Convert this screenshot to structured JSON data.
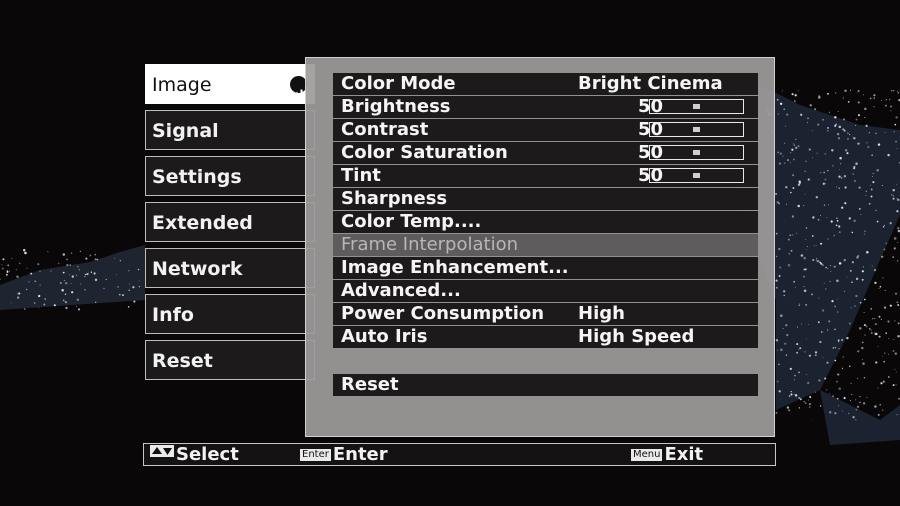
{
  "sidebar": {
    "tabs": [
      {
        "label": "Image",
        "active": true
      },
      {
        "label": "Signal"
      },
      {
        "label": "Settings"
      },
      {
        "label": "Extended"
      },
      {
        "label": "Network"
      },
      {
        "label": "Info"
      },
      {
        "label": "Reset"
      }
    ]
  },
  "menu": {
    "items": [
      {
        "label": "Color Mode",
        "value": "Bright Cinema"
      },
      {
        "label": "Brightness",
        "number": "50",
        "level": 0.5
      },
      {
        "label": "Contrast",
        "number": "50",
        "level": 0.5
      },
      {
        "label": "Color Saturation",
        "number": "50",
        "level": 0.5
      },
      {
        "label": "Tint",
        "number": "50",
        "level": 0.5
      },
      {
        "label": "Sharpness"
      },
      {
        "label": "Color Temp...."
      },
      {
        "label": "Frame Interpolation",
        "disabled": true
      },
      {
        "label": "Image Enhancement..."
      },
      {
        "label": "Advanced..."
      },
      {
        "label": "Power Consumption",
        "value": "High"
      },
      {
        "label": "Auto Iris",
        "value": "High Speed"
      }
    ],
    "reset_label": "Reset"
  },
  "footer": {
    "select_label": "Select",
    "enter_key": "Enter",
    "enter_label": "Enter",
    "menu_key": "Menu",
    "exit_label": "Exit"
  },
  "colors": {
    "panel_bg": "#9e9b9b",
    "row_bg": "#1d1a1b",
    "disabled_row_bg": "#5f5c5d",
    "active_tab_bg": "#ffffff"
  }
}
